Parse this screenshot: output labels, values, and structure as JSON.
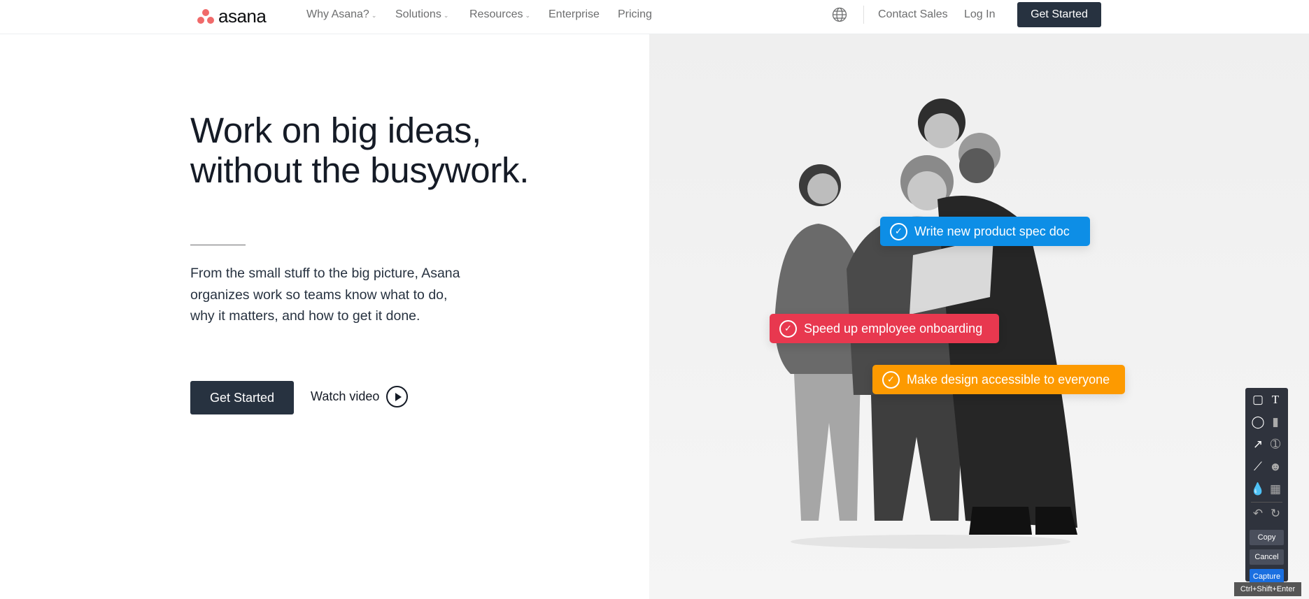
{
  "header": {
    "logo_text": "asana",
    "nav": [
      {
        "label": "Why Asana?",
        "dropdown": true
      },
      {
        "label": "Solutions",
        "dropdown": true
      },
      {
        "label": "Resources",
        "dropdown": true
      },
      {
        "label": "Enterprise",
        "dropdown": false
      },
      {
        "label": "Pricing",
        "dropdown": false
      }
    ],
    "language_icon": "globe-icon",
    "contact_sales": "Contact Sales",
    "log_in": "Log In",
    "get_started": "Get Started"
  },
  "hero": {
    "title_line1": "Work on big ideas,",
    "title_line2": "without the busywork.",
    "para_line1": "From the small stuff to the big picture, Asana",
    "para_line2": "organizes work so teams know what to do,",
    "para_line3": "why it matters, and how to get it done.",
    "cta": "Get Started",
    "watch_video": "Watch video"
  },
  "task_cards": [
    {
      "label": "Write new product spec doc",
      "color": "#0d8ee6"
    },
    {
      "label": "Speed up employee onboarding",
      "color": "#e8384f"
    },
    {
      "label": "Make design accessible to everyone",
      "color": "#fd9a00"
    }
  ],
  "capture_toolbar": {
    "tools": [
      "rectangle-icon",
      "text-icon",
      "ellipse-icon",
      "callout-icon",
      "arrow-icon",
      "number-icon",
      "pen-icon",
      "emoji-icon",
      "blur-icon",
      "image-icon",
      "undo-icon",
      "reset-icon"
    ],
    "copy": "Copy",
    "cancel": "Cancel",
    "capture": "Capture",
    "shortcut": "Ctrl+Shift+Enter"
  }
}
